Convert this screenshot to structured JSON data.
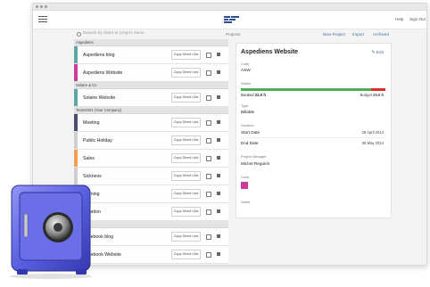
{
  "window": {
    "controls": [
      "close-dot",
      "minimize-dot",
      "maximize-dot"
    ]
  },
  "topbar": {
    "help": "Help",
    "signout": "Sign Out"
  },
  "toolbar": {
    "search_placeholder": "Search by client or project name",
    "projects": "Projects",
    "new_project": "New Project",
    "import": "Import",
    "archived": "Archived"
  },
  "groups": [
    {
      "label": "Aspediens",
      "rows": [
        {
          "name": "Aspediens blog",
          "color": "#5aa8a8"
        },
        {
          "name": "Aspediens Website",
          "color": "#cc3d9a"
        }
      ]
    },
    {
      "label": "Solaire & Co",
      "rows": [
        {
          "name": "Solaire Website",
          "color": "#5aa8a8"
        }
      ]
    },
    {
      "label": "Team2024 (Your Company)",
      "rows": [
        {
          "name": "Meeting",
          "color": "#4b4f6e"
        },
        {
          "name": "Public Holiday",
          "color": "#cfcfcf"
        },
        {
          "name": "Sales",
          "color": "#f0a050"
        },
        {
          "name": "Sickness",
          "color": "#cfcfcf"
        },
        {
          "name": "Training",
          "color": "#cfcfcf"
        },
        {
          "name": "Vacation",
          "color": "#cfcfcf"
        }
      ]
    },
    {
      "label": "",
      "rows": [
        {
          "name": "Facebook blog",
          "color": "#cfcfcf"
        },
        {
          "name": "Facebook Website",
          "color": "#cfcfcf"
        }
      ]
    }
  ],
  "row_copy_label": "Copy Direct Link",
  "details": {
    "title": "Aspediens Website",
    "edit": "Edit",
    "code_label": "Code",
    "code_value": "ASW",
    "status_label": "Status",
    "booked_label": "Booked",
    "booked_value": "22.0 h",
    "budget_label": "Budget",
    "budget_value": "20.0 h",
    "type_label": "Type",
    "type_value": "Billable",
    "duration_label": "Duration",
    "start_label": "Start Date",
    "start_value": "28 April 2014",
    "end_label": "End Date",
    "end_value": "08 May 2014",
    "pm_label": "Project Manager",
    "pm_value": "Michel Reguirin",
    "color_label": "Color",
    "color_value": "#cc3d9a",
    "notes_label": "Notes"
  },
  "colors": {
    "accent": "#4a6fa5",
    "booked": "#4caf50",
    "over_budget": "#d9342b"
  }
}
